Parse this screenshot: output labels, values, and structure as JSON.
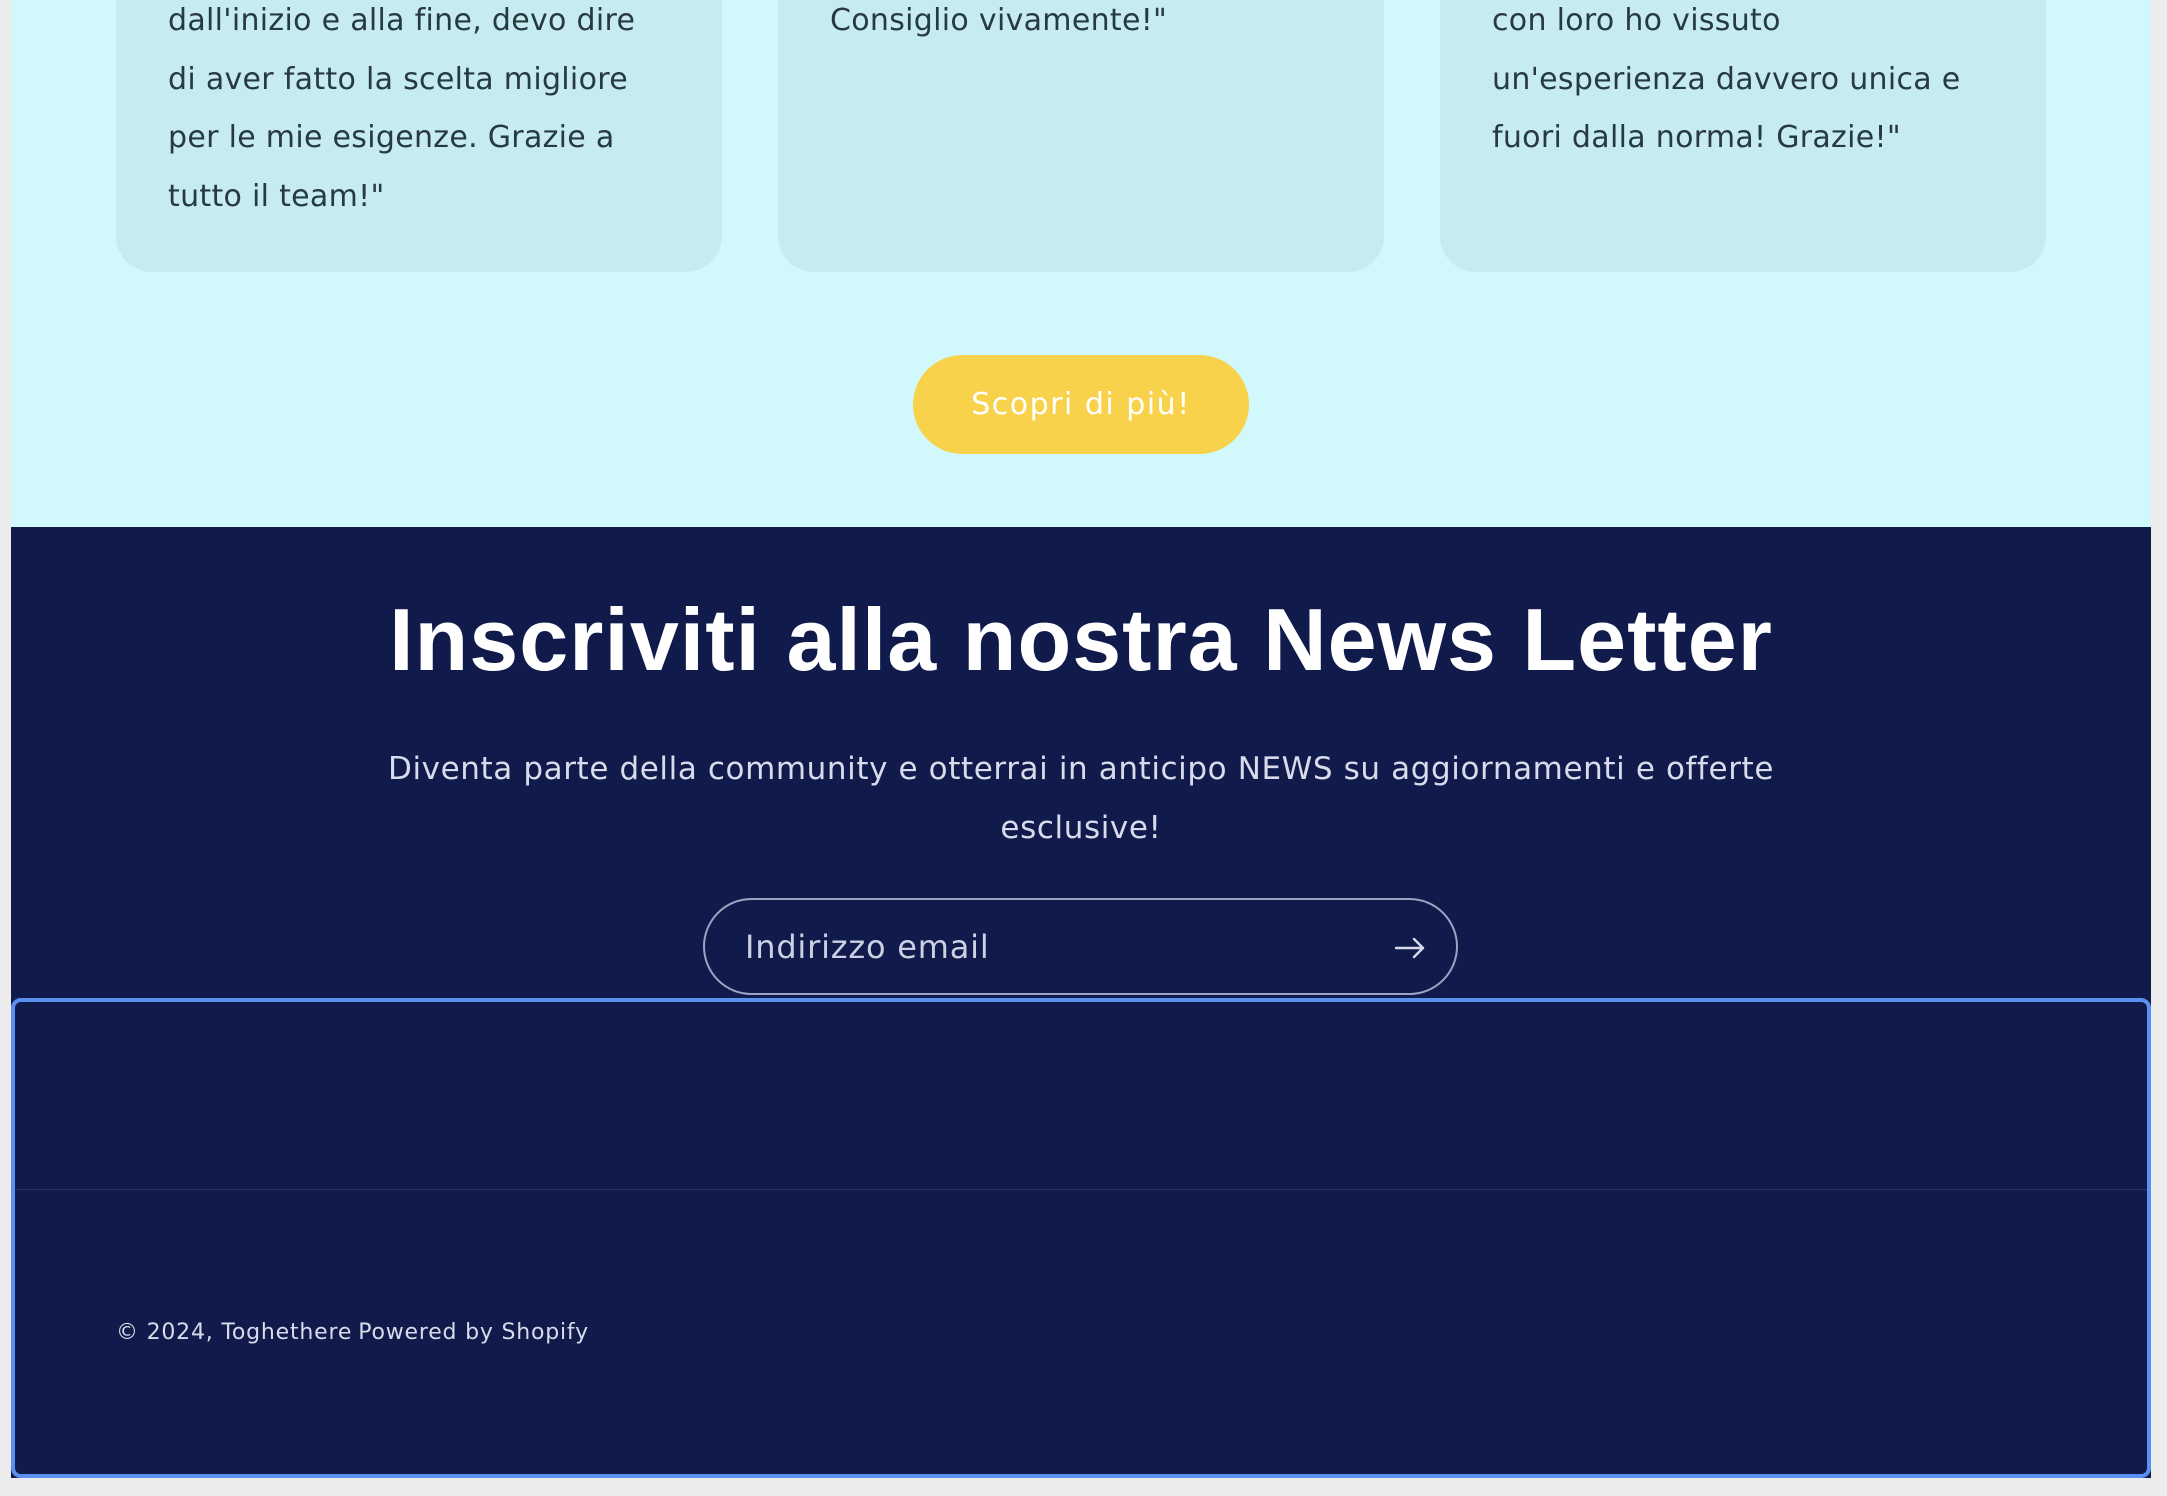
{
  "testimonials": {
    "cards": [
      {
        "lines": [
          "dall'inizio e alla fine, devo dire",
          "di aver fatto la scelta migliore",
          "per le mie esigenze. Grazie a",
          "tutto il team!\""
        ]
      },
      {
        "lines": [
          "Consiglio vivamente!\""
        ]
      },
      {
        "lines": [
          "con loro ho vissuto",
          "un'esperienza davvero unica e",
          "fuori dalla norma! Grazie!\""
        ]
      }
    ],
    "cta_label": "Scopri di più!"
  },
  "newsletter": {
    "title": "Inscriviti alla nostra News Letter",
    "subtitle": "Diventa parte della community e otterrai in anticipo NEWS su aggiornamenti e offerte esclusive!",
    "email_placeholder": "Indirizzo email",
    "submit_icon": "arrow-right-icon"
  },
  "footer": {
    "copyright": "© 2024, Toghethere",
    "powered_by": "Powered by Shopify"
  },
  "colors": {
    "testimonials_bg": "#d1f8fb",
    "card_bg": "#c6ecf1",
    "cta_bg": "#f8d24a",
    "newsletter_bg": "#111b4b",
    "footer_highlight_border": "#5b8ff0"
  }
}
